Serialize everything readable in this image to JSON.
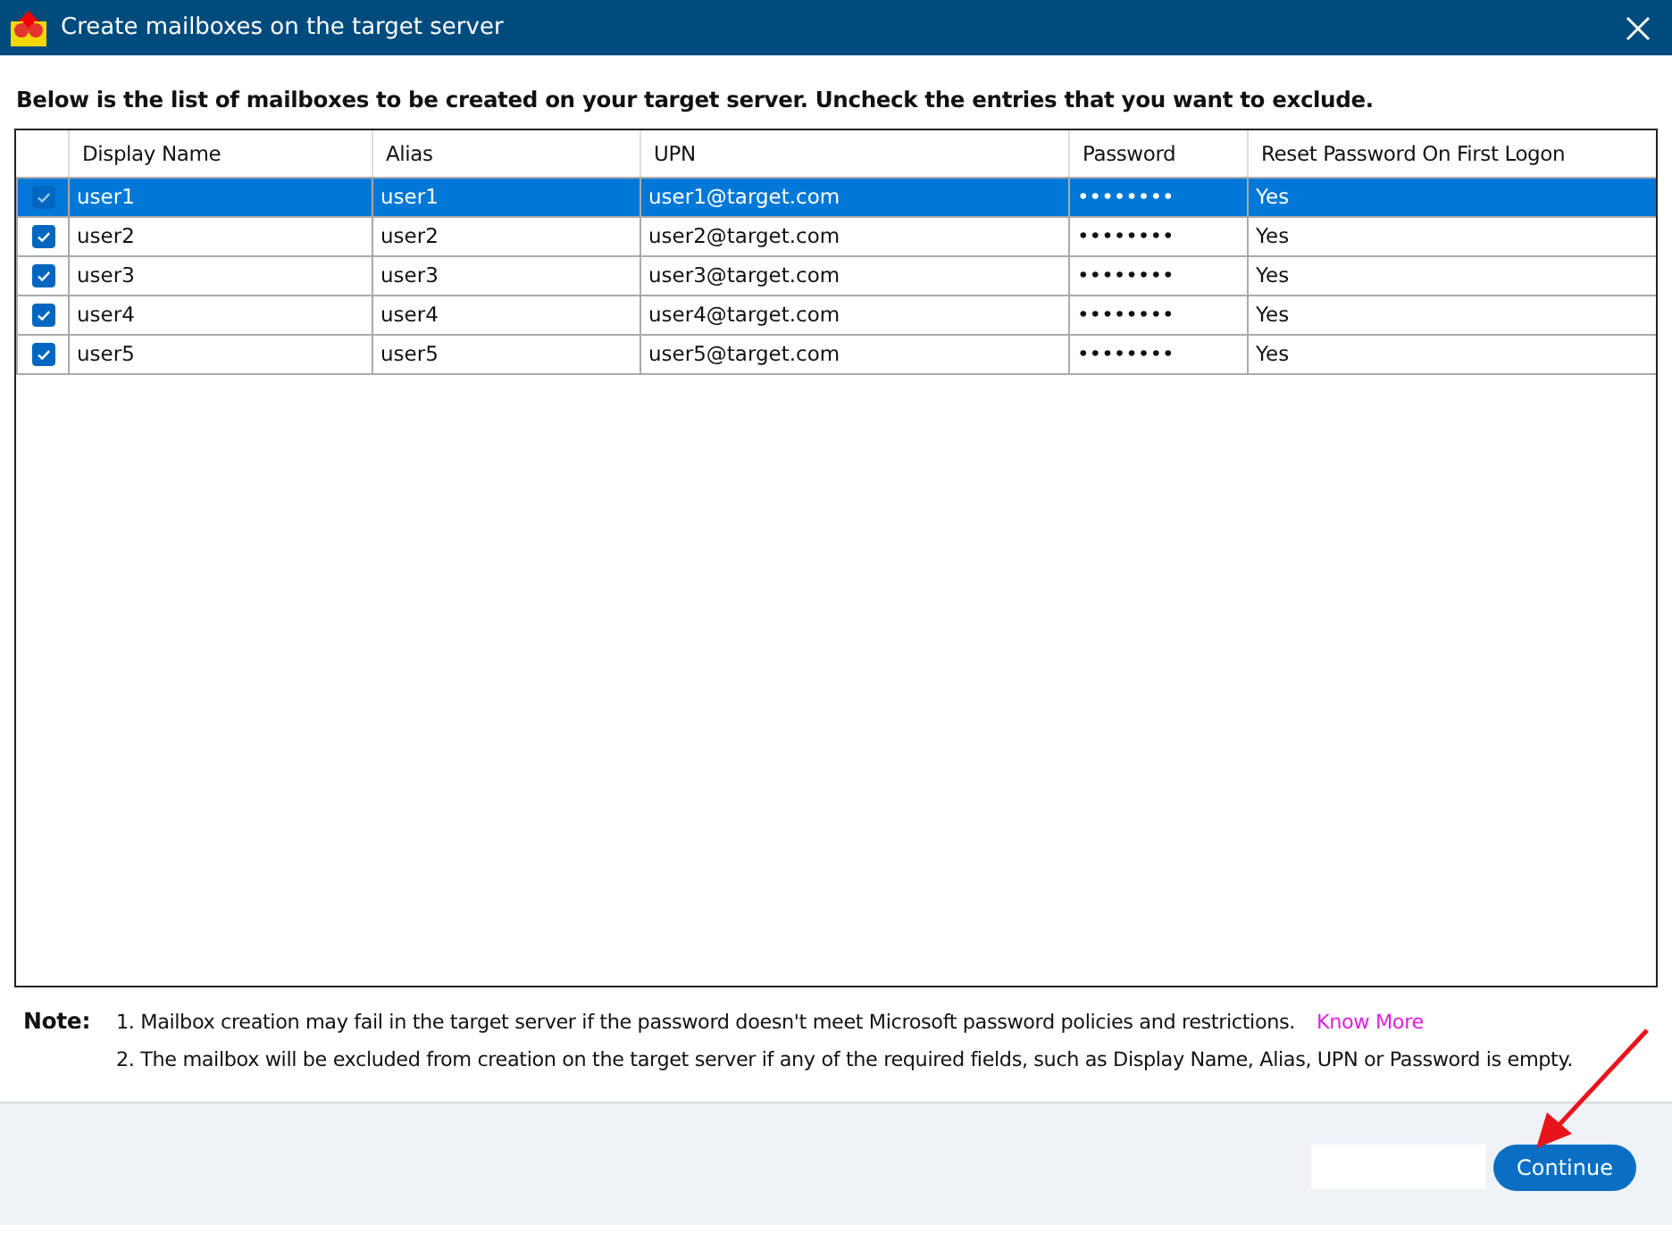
{
  "window": {
    "title": "Create mailboxes on the target server"
  },
  "instruction": "Below is the list of mailboxes to be created on your target server. Uncheck the entries that you want to exclude.",
  "table": {
    "columns": [
      "Display Name",
      "Alias",
      "UPN",
      "Password",
      "Reset Password On First Logon"
    ],
    "rows": [
      {
        "checked": true,
        "selected": true,
        "cells": [
          "user1",
          "user1",
          "user1@target.com",
          "••••••••",
          "Yes"
        ]
      },
      {
        "checked": true,
        "selected": false,
        "cells": [
          "user2",
          "user2",
          "user2@target.com",
          "••••••••",
          "Yes"
        ]
      },
      {
        "checked": true,
        "selected": false,
        "cells": [
          "user3",
          "user3",
          "user3@target.com",
          "••••••••",
          "Yes"
        ]
      },
      {
        "checked": true,
        "selected": false,
        "cells": [
          "user4",
          "user4",
          "user4@target.com",
          "••••••••",
          "Yes"
        ]
      },
      {
        "checked": true,
        "selected": false,
        "cells": [
          "user5",
          "user5",
          "user5@target.com",
          "••••••••",
          "Yes"
        ]
      }
    ]
  },
  "note": {
    "label": "Note:",
    "lines": [
      {
        "text": "1. Mailbox creation may fail in the target server if the password doesn't meet Microsoft password policies and restrictions.",
        "link": "Know More"
      },
      {
        "text": "2. The mailbox will be excluded from creation on the target server if any of the required fields, such as Display Name, Alias, UPN or Password is empty."
      }
    ]
  },
  "buttons": [
    {
      "kind": "blank"
    },
    {
      "kind": "primary",
      "label": "Continue"
    }
  ]
}
